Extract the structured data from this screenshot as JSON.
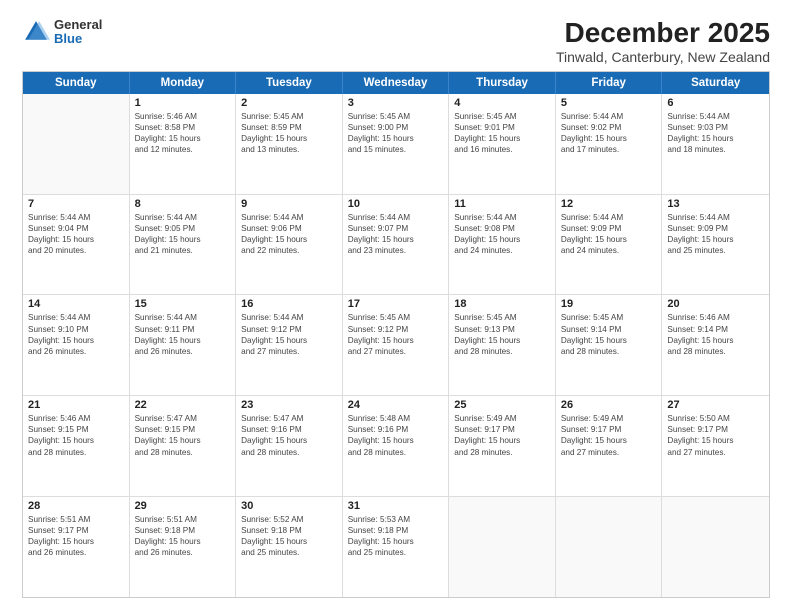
{
  "logo": {
    "general": "General",
    "blue": "Blue"
  },
  "title": "December 2025",
  "subtitle": "Tinwald, Canterbury, New Zealand",
  "days_of_week": [
    "Sunday",
    "Monday",
    "Tuesday",
    "Wednesday",
    "Thursday",
    "Friday",
    "Saturday"
  ],
  "weeks": [
    [
      {
        "day": "",
        "empty": true
      },
      {
        "day": "1",
        "sunrise": "5:46 AM",
        "sunset": "8:58 PM",
        "daylight": "15 hours and 12 minutes."
      },
      {
        "day": "2",
        "sunrise": "5:45 AM",
        "sunset": "8:59 PM",
        "daylight": "15 hours and 13 minutes."
      },
      {
        "day": "3",
        "sunrise": "5:45 AM",
        "sunset": "9:00 PM",
        "daylight": "15 hours and 15 minutes."
      },
      {
        "day": "4",
        "sunrise": "5:45 AM",
        "sunset": "9:01 PM",
        "daylight": "15 hours and 16 minutes."
      },
      {
        "day": "5",
        "sunrise": "5:44 AM",
        "sunset": "9:02 PM",
        "daylight": "15 hours and 17 minutes."
      },
      {
        "day": "6",
        "sunrise": "5:44 AM",
        "sunset": "9:03 PM",
        "daylight": "15 hours and 18 minutes."
      }
    ],
    [
      {
        "day": "7",
        "sunrise": "5:44 AM",
        "sunset": "9:04 PM",
        "daylight": "15 hours and 20 minutes."
      },
      {
        "day": "8",
        "sunrise": "5:44 AM",
        "sunset": "9:05 PM",
        "daylight": "15 hours and 21 minutes."
      },
      {
        "day": "9",
        "sunrise": "5:44 AM",
        "sunset": "9:06 PM",
        "daylight": "15 hours and 22 minutes."
      },
      {
        "day": "10",
        "sunrise": "5:44 AM",
        "sunset": "9:07 PM",
        "daylight": "15 hours and 23 minutes."
      },
      {
        "day": "11",
        "sunrise": "5:44 AM",
        "sunset": "9:08 PM",
        "daylight": "15 hours and 24 minutes."
      },
      {
        "day": "12",
        "sunrise": "5:44 AM",
        "sunset": "9:09 PM",
        "daylight": "15 hours and 24 minutes."
      },
      {
        "day": "13",
        "sunrise": "5:44 AM",
        "sunset": "9:09 PM",
        "daylight": "15 hours and 25 minutes."
      }
    ],
    [
      {
        "day": "14",
        "sunrise": "5:44 AM",
        "sunset": "9:10 PM",
        "daylight": "15 hours and 26 minutes."
      },
      {
        "day": "15",
        "sunrise": "5:44 AM",
        "sunset": "9:11 PM",
        "daylight": "15 hours and 26 minutes."
      },
      {
        "day": "16",
        "sunrise": "5:44 AM",
        "sunset": "9:12 PM",
        "daylight": "15 hours and 27 minutes."
      },
      {
        "day": "17",
        "sunrise": "5:45 AM",
        "sunset": "9:12 PM",
        "daylight": "15 hours and 27 minutes."
      },
      {
        "day": "18",
        "sunrise": "5:45 AM",
        "sunset": "9:13 PM",
        "daylight": "15 hours and 28 minutes."
      },
      {
        "day": "19",
        "sunrise": "5:45 AM",
        "sunset": "9:14 PM",
        "daylight": "15 hours and 28 minutes."
      },
      {
        "day": "20",
        "sunrise": "5:46 AM",
        "sunset": "9:14 PM",
        "daylight": "15 hours and 28 minutes."
      }
    ],
    [
      {
        "day": "21",
        "sunrise": "5:46 AM",
        "sunset": "9:15 PM",
        "daylight": "15 hours and 28 minutes."
      },
      {
        "day": "22",
        "sunrise": "5:47 AM",
        "sunset": "9:15 PM",
        "daylight": "15 hours and 28 minutes."
      },
      {
        "day": "23",
        "sunrise": "5:47 AM",
        "sunset": "9:16 PM",
        "daylight": "15 hours and 28 minutes."
      },
      {
        "day": "24",
        "sunrise": "5:48 AM",
        "sunset": "9:16 PM",
        "daylight": "15 hours and 28 minutes."
      },
      {
        "day": "25",
        "sunrise": "5:49 AM",
        "sunset": "9:17 PM",
        "daylight": "15 hours and 28 minutes."
      },
      {
        "day": "26",
        "sunrise": "5:49 AM",
        "sunset": "9:17 PM",
        "daylight": "15 hours and 27 minutes."
      },
      {
        "day": "27",
        "sunrise": "5:50 AM",
        "sunset": "9:17 PM",
        "daylight": "15 hours and 27 minutes."
      }
    ],
    [
      {
        "day": "28",
        "sunrise": "5:51 AM",
        "sunset": "9:17 PM",
        "daylight": "15 hours and 26 minutes."
      },
      {
        "day": "29",
        "sunrise": "5:51 AM",
        "sunset": "9:18 PM",
        "daylight": "15 hours and 26 minutes."
      },
      {
        "day": "30",
        "sunrise": "5:52 AM",
        "sunset": "9:18 PM",
        "daylight": "15 hours and 25 minutes."
      },
      {
        "day": "31",
        "sunrise": "5:53 AM",
        "sunset": "9:18 PM",
        "daylight": "15 hours and 25 minutes."
      },
      {
        "day": "",
        "empty": true
      },
      {
        "day": "",
        "empty": true
      },
      {
        "day": "",
        "empty": true
      }
    ]
  ]
}
